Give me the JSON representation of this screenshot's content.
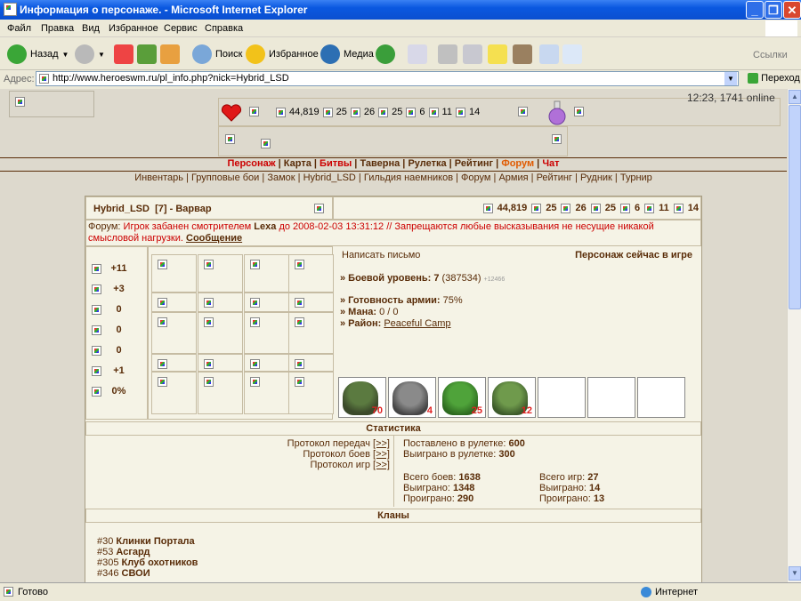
{
  "window": {
    "title": "Информация о персонаже. - Microsoft Internet Explorer"
  },
  "menu": [
    "Файл",
    "Правка",
    "Вид",
    "Избранное",
    "Сервис",
    "Справка"
  ],
  "toolbar": {
    "back": "Назад",
    "search": "Поиск",
    "favorites": "Избранное",
    "media": "Медиа",
    "links": "Ссылки"
  },
  "address": {
    "label": "Адрес:",
    "url": "http://www.heroeswm.ru/pl_info.php?nick=Hybrid_LSD",
    "go": "Переход"
  },
  "header": {
    "clock": "12:23, 1741 online",
    "resources": [
      "44,819",
      "25",
      "26",
      "25",
      "6",
      "11",
      "14"
    ]
  },
  "nav_main": {
    "items": [
      "Персонаж",
      "Карта",
      "Битвы",
      "Таверна",
      "Рулетка",
      "Рейтинг",
      "Форум",
      "Чат"
    ]
  },
  "nav_sub": {
    "items": [
      "Инвентарь",
      "Групповые бои",
      "Замок",
      "Hybrid_LSD",
      "Гильдия наемников",
      "Форум",
      "Армия",
      "Рейтинг",
      "Рудник",
      "Турнир"
    ]
  },
  "character": {
    "name": "Hybrid_LSD",
    "level": "[7]",
    "class": "- Варвар",
    "resources": [
      "44,819",
      "25",
      "26",
      "25",
      "6",
      "11",
      "14"
    ]
  },
  "ban": {
    "prefix": "Форум:",
    "text_a": "Игрок забанен смотрителем",
    "moderator": "Lexa",
    "text_b": "до 2008-02-03 13:31:12 // Запрещаются любые высказывания не несущие никакой смысловой нагрузки.",
    "link": "Сообщение"
  },
  "stats": [
    "+11",
    "+3",
    "0",
    "0",
    "0",
    "+1",
    "0%"
  ],
  "info": {
    "write": "Написать письмо",
    "online": "Персонаж сейчас в игре",
    "level_label": "» Боевой уровень:",
    "level_val": "7",
    "exp": "(387534)",
    "exp_extra": "+12466",
    "army_label": "» Готовность армии:",
    "army_val": "75%",
    "mana_label": "» Мана:",
    "mana_val": "0 / 0",
    "region_label": "» Район:",
    "region_val": "Peaceful Camp"
  },
  "army": {
    "counts": [
      "70",
      "4",
      "25",
      "12"
    ],
    "colors": [
      "#4f6a38",
      "#6f6f70",
      "#3e8a2a",
      "#5a8a3c"
    ]
  },
  "statistics": {
    "title": "Статистика",
    "protocols": [
      {
        "label": "Протокол передач",
        "link": "[>>]"
      },
      {
        "label": "Протокол боев",
        "link": "[>>]"
      },
      {
        "label": "Протокол игр",
        "link": "[>>]"
      }
    ],
    "roulette_bet_label": "Поставлено в рулетке:",
    "roulette_bet": "600",
    "roulette_won_label": "Выиграно в рулетке:",
    "roulette_won": "300",
    "battles_total_label": "Всего боев:",
    "battles_total": "1638",
    "battles_won_label": "Выиграно:",
    "battles_won": "1348",
    "battles_lost_label": "Проиграно:",
    "battles_lost": "290",
    "games_total_label": "Всего игр:",
    "games_total": "27",
    "games_won_label": "Выиграно:",
    "games_won": "14",
    "games_lost_label": "Проиграно:",
    "games_lost": "13"
  },
  "clans": {
    "title": "Кланы",
    "items": [
      {
        "id": "#30",
        "name": "Клинки Портала"
      },
      {
        "id": "#53",
        "name": "Асгард"
      },
      {
        "id": "#305",
        "name": "Клуб охотников"
      },
      {
        "id": "#346",
        "name": "СВОИ"
      }
    ]
  },
  "status": {
    "left": "Готово",
    "right": "Интернет"
  },
  "colors": {
    "brand": "#592c08",
    "accent_red": "#cc0000",
    "forum_orange": "#e05a00"
  }
}
